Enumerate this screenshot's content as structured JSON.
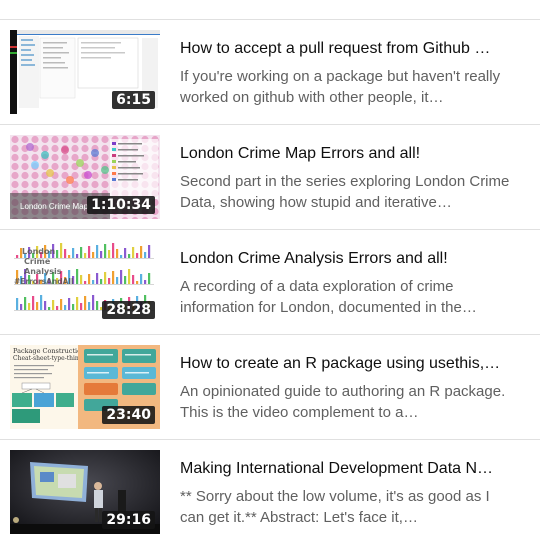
{
  "videos": [
    {
      "title": "How to accept a pull request from Github …",
      "description": "If you're working on a package but haven't really worked on github with other people, it…",
      "duration": "6:15",
      "thumbnail_icon": "screen-recording-thumbnail"
    },
    {
      "title": "London Crime Map Errors and all!",
      "description": "Second part in the series exploring London Crime Data, showing how stupid and iterative…",
      "duration": "1:10:34",
      "thumbnail_icon": "crime-map-thumbnail",
      "thumbnail_text": "London Crime Map"
    },
    {
      "title": "London Crime Analysis Errors and all!",
      "description": "A recording of a data exploration of crime information for London, documented in the…",
      "duration": "28:28",
      "thumbnail_icon": "bar-charts-thumbnail",
      "thumbnail_text": [
        "London",
        "Crime",
        "Analysis",
        "#ErrorsAndAll"
      ]
    },
    {
      "title": "How to create an R package using usethis,…",
      "description": "An opinionated guide to authoring an R package. This is the video complement to a…",
      "duration": "23:40",
      "thumbnail_icon": "cheatsheet-thumbnail",
      "thumbnail_text": [
        "Package Construction",
        "Cheat-sheet-type-thing"
      ]
    },
    {
      "title": "Making International Development Data N…",
      "description": "** Sorry about the low volume, it's as good as I can get it.** Abstract: Let's face it,…",
      "duration": "29:16",
      "thumbnail_icon": "conference-talk-thumbnail"
    }
  ]
}
